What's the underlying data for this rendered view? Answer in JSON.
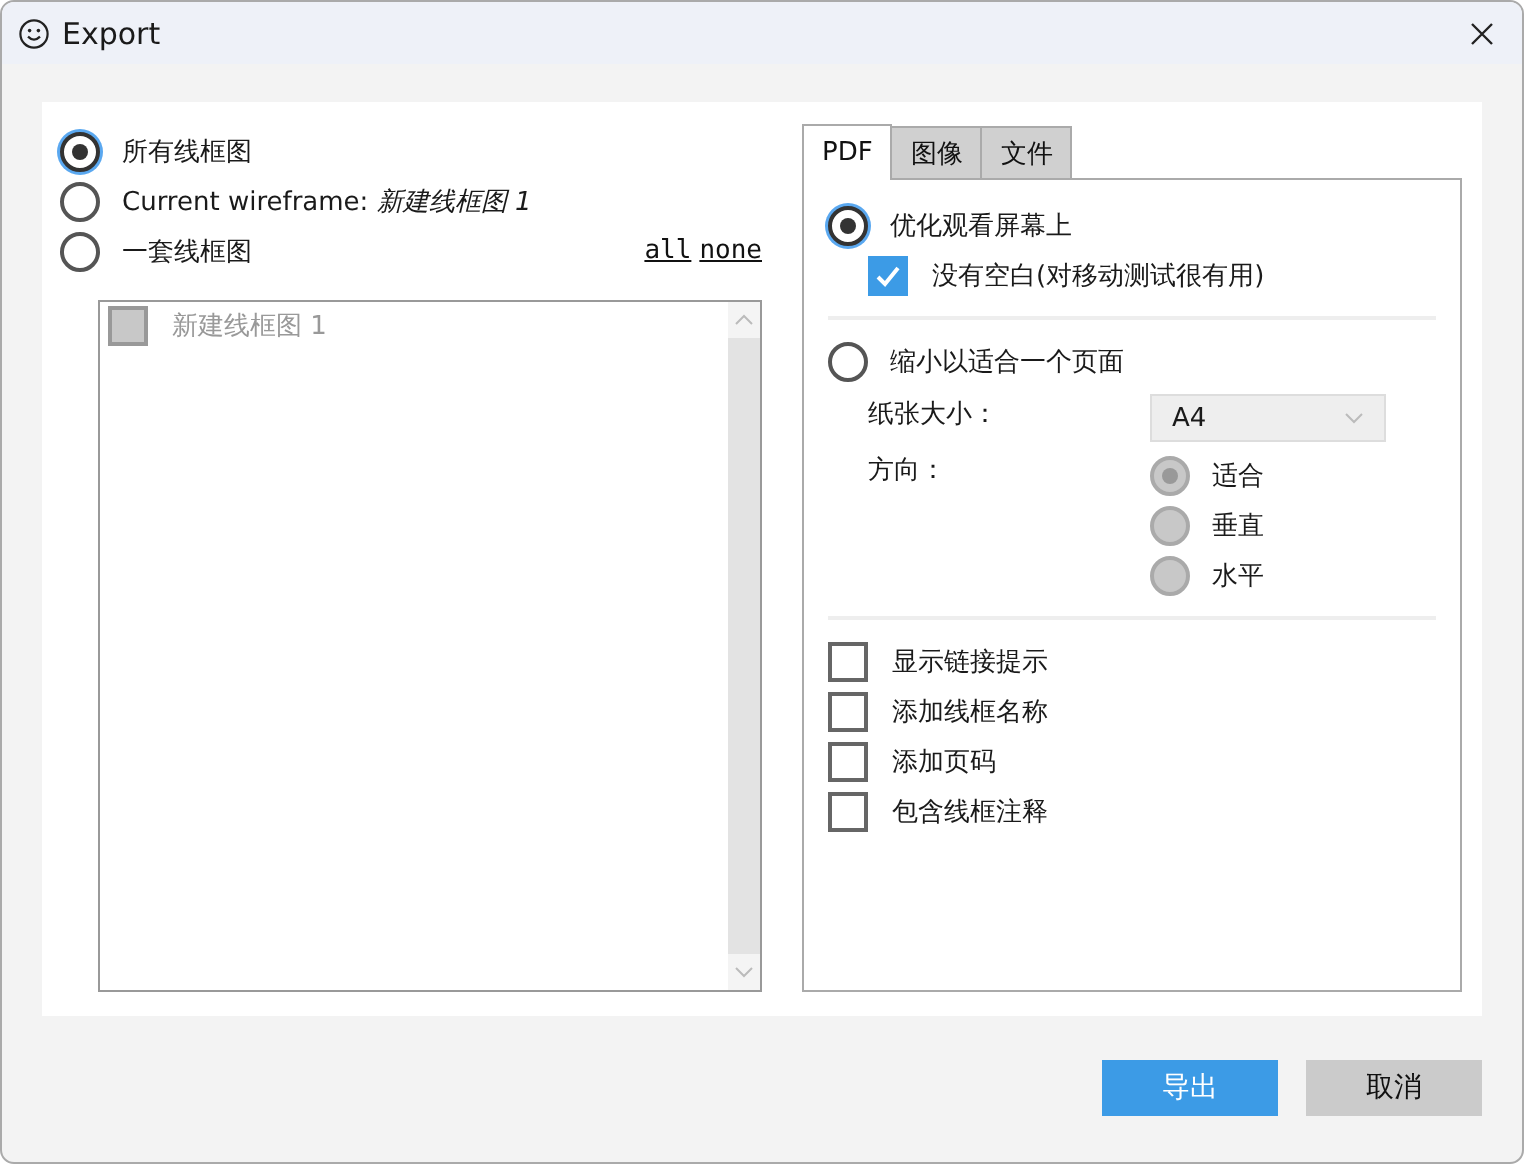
{
  "window": {
    "title": "Export"
  },
  "scope_options": [
    {
      "label": "所有线框图",
      "selected": true
    },
    {
      "label": "Current wireframe: *新建线框图 1*",
      "selected": false
    },
    {
      "label": "一套线框图",
      "selected": false
    }
  ],
  "links": [
    "all",
    "none"
  ],
  "wireframe_list": {
    "items": [
      {
        "label": "新建线框图 1",
        "checked": false,
        "disabled": true
      }
    ]
  },
  "tabs": [
    {
      "label": "PDF",
      "selected": true
    },
    {
      "label": "图像",
      "selected": false
    },
    {
      "label": "文件",
      "selected": false
    }
  ],
  "pdf": {
    "optimize": {
      "label": "优化观看屏幕上",
      "selected": true,
      "no_margin": {
        "label": "没有空白(对移动测试很有用)",
        "checked": true
      }
    },
    "shrink": {
      "label": "缩小以适合一个页面",
      "selected": false,
      "paper_size": {
        "label": "纸张大小：",
        "value": "A4",
        "disabled": true
      },
      "orientation": {
        "label": "方向：",
        "options": [
          {
            "label": "适合",
            "selected": true,
            "disabled": true
          },
          {
            "label": "垂直",
            "selected": false,
            "disabled": true
          },
          {
            "label": "水平",
            "selected": false,
            "disabled": true
          }
        ]
      }
    },
    "options": [
      {
        "label": "显示链接提示",
        "checked": false
      },
      {
        "label": "添加线框名称",
        "checked": false
      },
      {
        "label": "添加页码",
        "checked": false
      },
      {
        "label": "包含线框注释",
        "checked": false
      }
    ]
  },
  "buttons": [
    {
      "label": "导出",
      "kind": "primary"
    },
    {
      "label": "取消",
      "kind": "secondary"
    }
  ]
}
